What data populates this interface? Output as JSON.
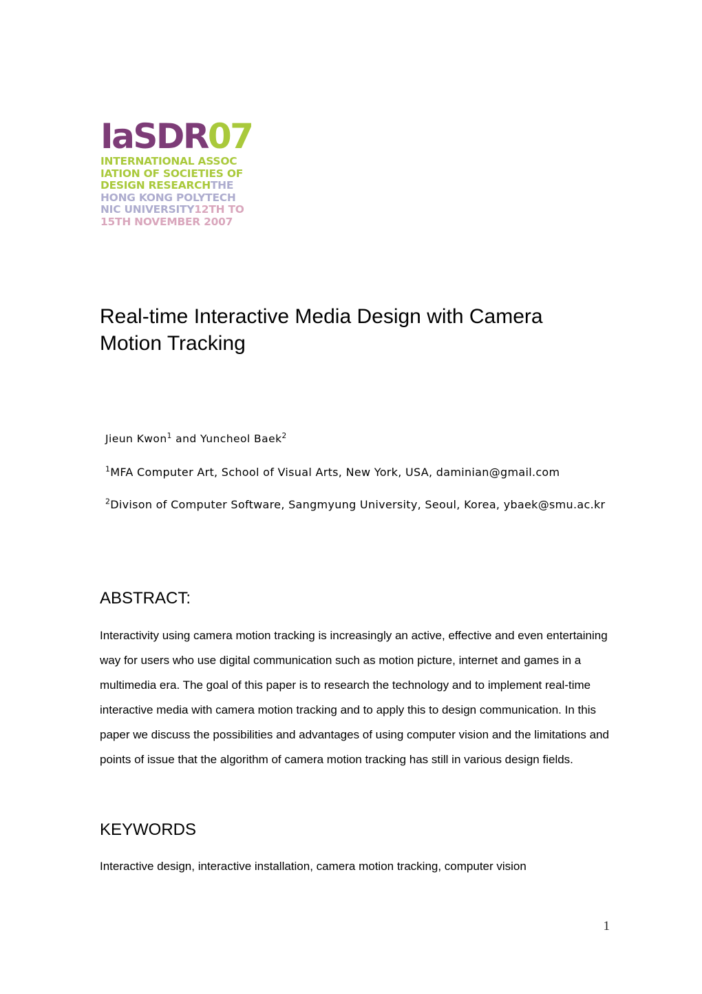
{
  "logo": {
    "wordmark_main": "IaSDR",
    "wordmark_accent": "07",
    "lines": [
      {
        "text": "INTERNATIONAL ASSOC",
        "color_name": "green",
        "color": "#A9C93B"
      },
      {
        "text": "IATION OF SOCIETIES OF",
        "color_name": "green",
        "color": "#A9C93B"
      },
      {
        "text": "DESIGN RESEARCH",
        "color_name": "green",
        "color": "#A9C93B"
      },
      {
        "text": "THE",
        "color_name": "lilac",
        "color": "#ADACCE"
      },
      {
        "text": "HONG KONG POLYTECH",
        "color_name": "lilac",
        "color": "#ADACCE"
      },
      {
        "text": "NIC UNIVERSITY",
        "color_name": "lilac",
        "color": "#ADACCE"
      },
      {
        "text": "12TH TO",
        "color_name": "pink",
        "color": "#D9A6BC"
      },
      {
        "text": "15TH NOVEMBER 2007",
        "color_name": "pink",
        "color": "#D9A6BC"
      }
    ],
    "colors": {
      "purple": "#7D3C77",
      "green": "#A9C93B",
      "lilac": "#ADACCE",
      "pink": "#D9A6BC"
    }
  },
  "title": "Real-time Interactive Media Design with Camera Motion Tracking",
  "authors": {
    "line": "Jieun Kwon",
    "marker1": "1",
    "connector": " and Yuncheol Baek",
    "marker2": "2"
  },
  "affiliations": [
    {
      "marker": "1",
      "text": "MFA Computer Art, School of Visual Arts, New York, USA, daminian@gmail.com"
    },
    {
      "marker": "2",
      "text": "Divison of Computer Software, Sangmyung University, Seoul, Korea, ybaek@smu.ac.kr"
    }
  ],
  "abstract": {
    "heading": "ABSTRACT:",
    "body": "Interactivity using camera motion tracking is increasingly an active, effective and even entertaining way for users who use digital communication such as motion picture, internet and games in a multimedia era. The goal of this paper is to research the technology and to implement real-time interactive media with camera motion tracking and to apply this to design communication. In this paper we discuss the possibilities and advantages of using computer vision and the limitations and points of issue that the algorithm of camera motion tracking has still in various design fields."
  },
  "keywords": {
    "heading": "KEYWORDS",
    "body": "Interactive design, interactive installation, camera motion tracking, computer vision"
  },
  "page_number": "1"
}
